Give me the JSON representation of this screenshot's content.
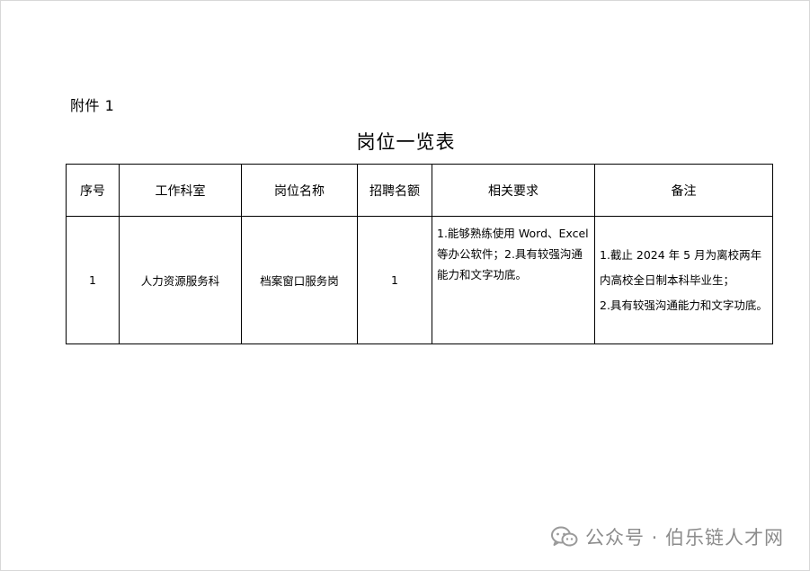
{
  "attachment_label": "附件 1",
  "title": "岗位一览表",
  "table": {
    "headers": [
      "序号",
      "工作科室",
      "岗位名称",
      "招聘名额",
      "相关要求",
      "备注"
    ],
    "rows": [
      {
        "index": "1",
        "department": "人力资源服务科",
        "position": "档案窗口服务岗",
        "quota": "1",
        "requirements": "1.能够熟练使用 Word、Excel 等办公软件；2.具有较强沟通能力和文字功底。",
        "notes_line1": "1.截止 2024 年 5 月为离校两年内高校全日制本科毕业生；",
        "notes_line2": "2.具有较强沟通能力和文字功底。"
      }
    ]
  },
  "watermark": {
    "icon": "wechat-icon",
    "text": "公众号 · 伯乐链人才网"
  }
}
